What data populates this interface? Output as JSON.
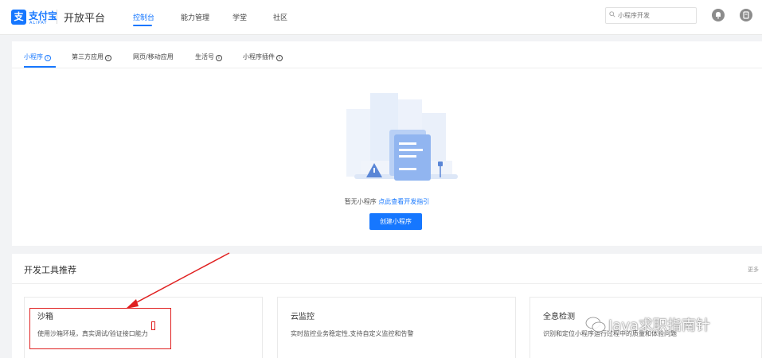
{
  "header": {
    "logo_mark": "支",
    "logo_cn": "支付宝",
    "logo_en": "ALIPAY",
    "platform": "开放平台",
    "nav": [
      "控制台",
      "能力管理",
      "学堂",
      "社区"
    ],
    "active_nav": "控制台",
    "search_placeholder": "小程序开发"
  },
  "tabs": [
    {
      "label": "小程序",
      "info": "i"
    },
    {
      "label": "第三方应用",
      "info": "i"
    },
    {
      "label": "网页/移动应用",
      "info": ""
    },
    {
      "label": "生活号",
      "info": "i"
    },
    {
      "label": "小程序插件",
      "info": "i"
    }
  ],
  "empty_state": {
    "text": "暂无小程序",
    "link": "点此查看开发指引",
    "button": "创建小程序"
  },
  "tools": {
    "title": "开发工具推荐",
    "more": "更多",
    "cards": [
      {
        "title": "沙箱",
        "desc": "使用沙箱环境，真实调试/验证接口能力"
      },
      {
        "title": "云监控",
        "desc": "实时监控业务稳定性,支持自定义监控和告警"
      },
      {
        "title": "全息检测",
        "desc": "识别和定位小程序运行过程中的质量和体验问题"
      }
    ]
  },
  "watermark": "Java求职指南针",
  "colors": {
    "brand": "#1677ff",
    "annotation": "#e02020",
    "background": "#f2f3f5"
  }
}
